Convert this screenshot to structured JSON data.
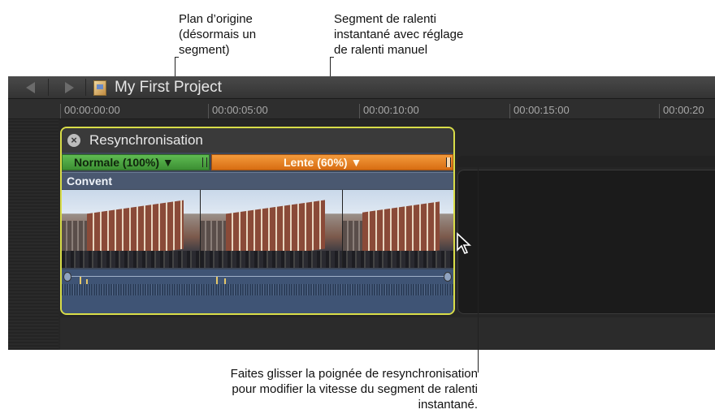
{
  "callouts": {
    "original": [
      "Plan d’origine",
      "(désormais un",
      "segment)"
    ],
    "slow_segment": [
      "Segment de ralenti",
      "instantané avec réglage",
      "de ralenti manuel"
    ],
    "retime_handle": [
      "Faites glisser la poignée de resynchronisation",
      "pour modifier la vitesse du segment de ralenti",
      "instantané."
    ]
  },
  "toolbar": {
    "project_title": "My First Project",
    "back_icon": "back-arrow-icon",
    "forward_icon": "forward-arrow-icon",
    "project_icon": "project-icon"
  },
  "ruler": {
    "timecodes": [
      "00:00:00:00",
      "00:00:05:00",
      "00:00:10:00",
      "00:00:15:00",
      "00:00:20"
    ]
  },
  "compound": {
    "title": "Resynchronisation",
    "close_icon": "close-icon"
  },
  "segments": {
    "normal_label": "Normale (100%) ▼",
    "slow_label": "Lente (60%) ▼",
    "normal_color": "#4ea842",
    "slow_color": "#e9821f"
  },
  "clip": {
    "name": "Convent"
  },
  "colors": {
    "selection": "#d9dd48",
    "timeline_bg": "#262626"
  }
}
